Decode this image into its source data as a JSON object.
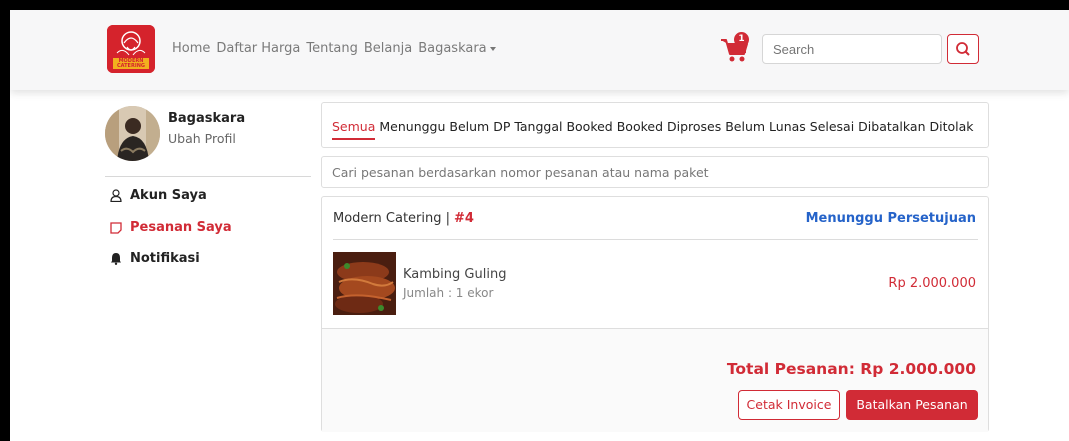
{
  "navbar": {
    "logo_text": "MODERN CATERING",
    "links": [
      "Home",
      "Daftar Harga",
      "Tentang",
      "Belanja"
    ],
    "account_menu": "Bagaskara",
    "cart_count": "1",
    "search_placeholder": "Search",
    "icons": {
      "cart": "cart-icon",
      "search": "search-icon",
      "caret": "chevron-down-icon"
    }
  },
  "sidebar": {
    "profile_name": "Bagaskara",
    "edit_profile": "Ubah Profil",
    "items": [
      {
        "label": "Akun Saya",
        "icon": "user-icon",
        "color": "#222222"
      },
      {
        "label": "Pesanan Saya",
        "icon": "order-icon",
        "color": "#d12b36",
        "active": true
      },
      {
        "label": "Notifikasi",
        "icon": "bell-icon",
        "color": "#222222"
      }
    ]
  },
  "tabs": {
    "active": "Semua",
    "others": "Menunggu Belum DP Tanggal Booked Booked Diproses Belum Lunas Selesai Dibatalkan Ditolak"
  },
  "filter_placeholder": "Cari pesanan berdasarkan nomor pesanan atau nama paket",
  "order": {
    "store": "Modern Catering |",
    "number": "#4",
    "status": "Menunggu Persetujuan",
    "item": {
      "name": "Kambing Guling",
      "quantity": "Jumlah : 1 ekor",
      "price": "Rp 2.000.000"
    },
    "total": "Total Pesanan: Rp 2.000.000",
    "invoice_button": "Cetak Invoice",
    "cancel_button": "Batalkan Pesanan"
  },
  "colors": {
    "accent": "#d12b36",
    "status": "#2563c9",
    "navbar": "#f7f7f8"
  }
}
